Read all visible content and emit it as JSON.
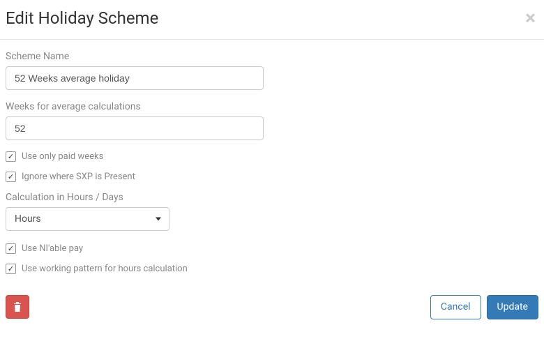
{
  "header": {
    "title": "Edit Holiday Scheme"
  },
  "form": {
    "scheme_name_label": "Scheme Name",
    "scheme_name_value": "52 Weeks average holiday",
    "weeks_label": "Weeks for average calculations",
    "weeks_value": "52",
    "use_paid_weeks_label": "Use only paid weeks",
    "ignore_sxp_label": "Ignore where SXP is Present",
    "calc_unit_label": "Calculation in Hours / Days",
    "calc_unit_value": "Hours",
    "use_niable_label": "Use NI'able pay",
    "use_working_pattern_label": "Use working pattern for hours calculation"
  },
  "footer": {
    "cancel_label": "Cancel",
    "update_label": "Update"
  }
}
